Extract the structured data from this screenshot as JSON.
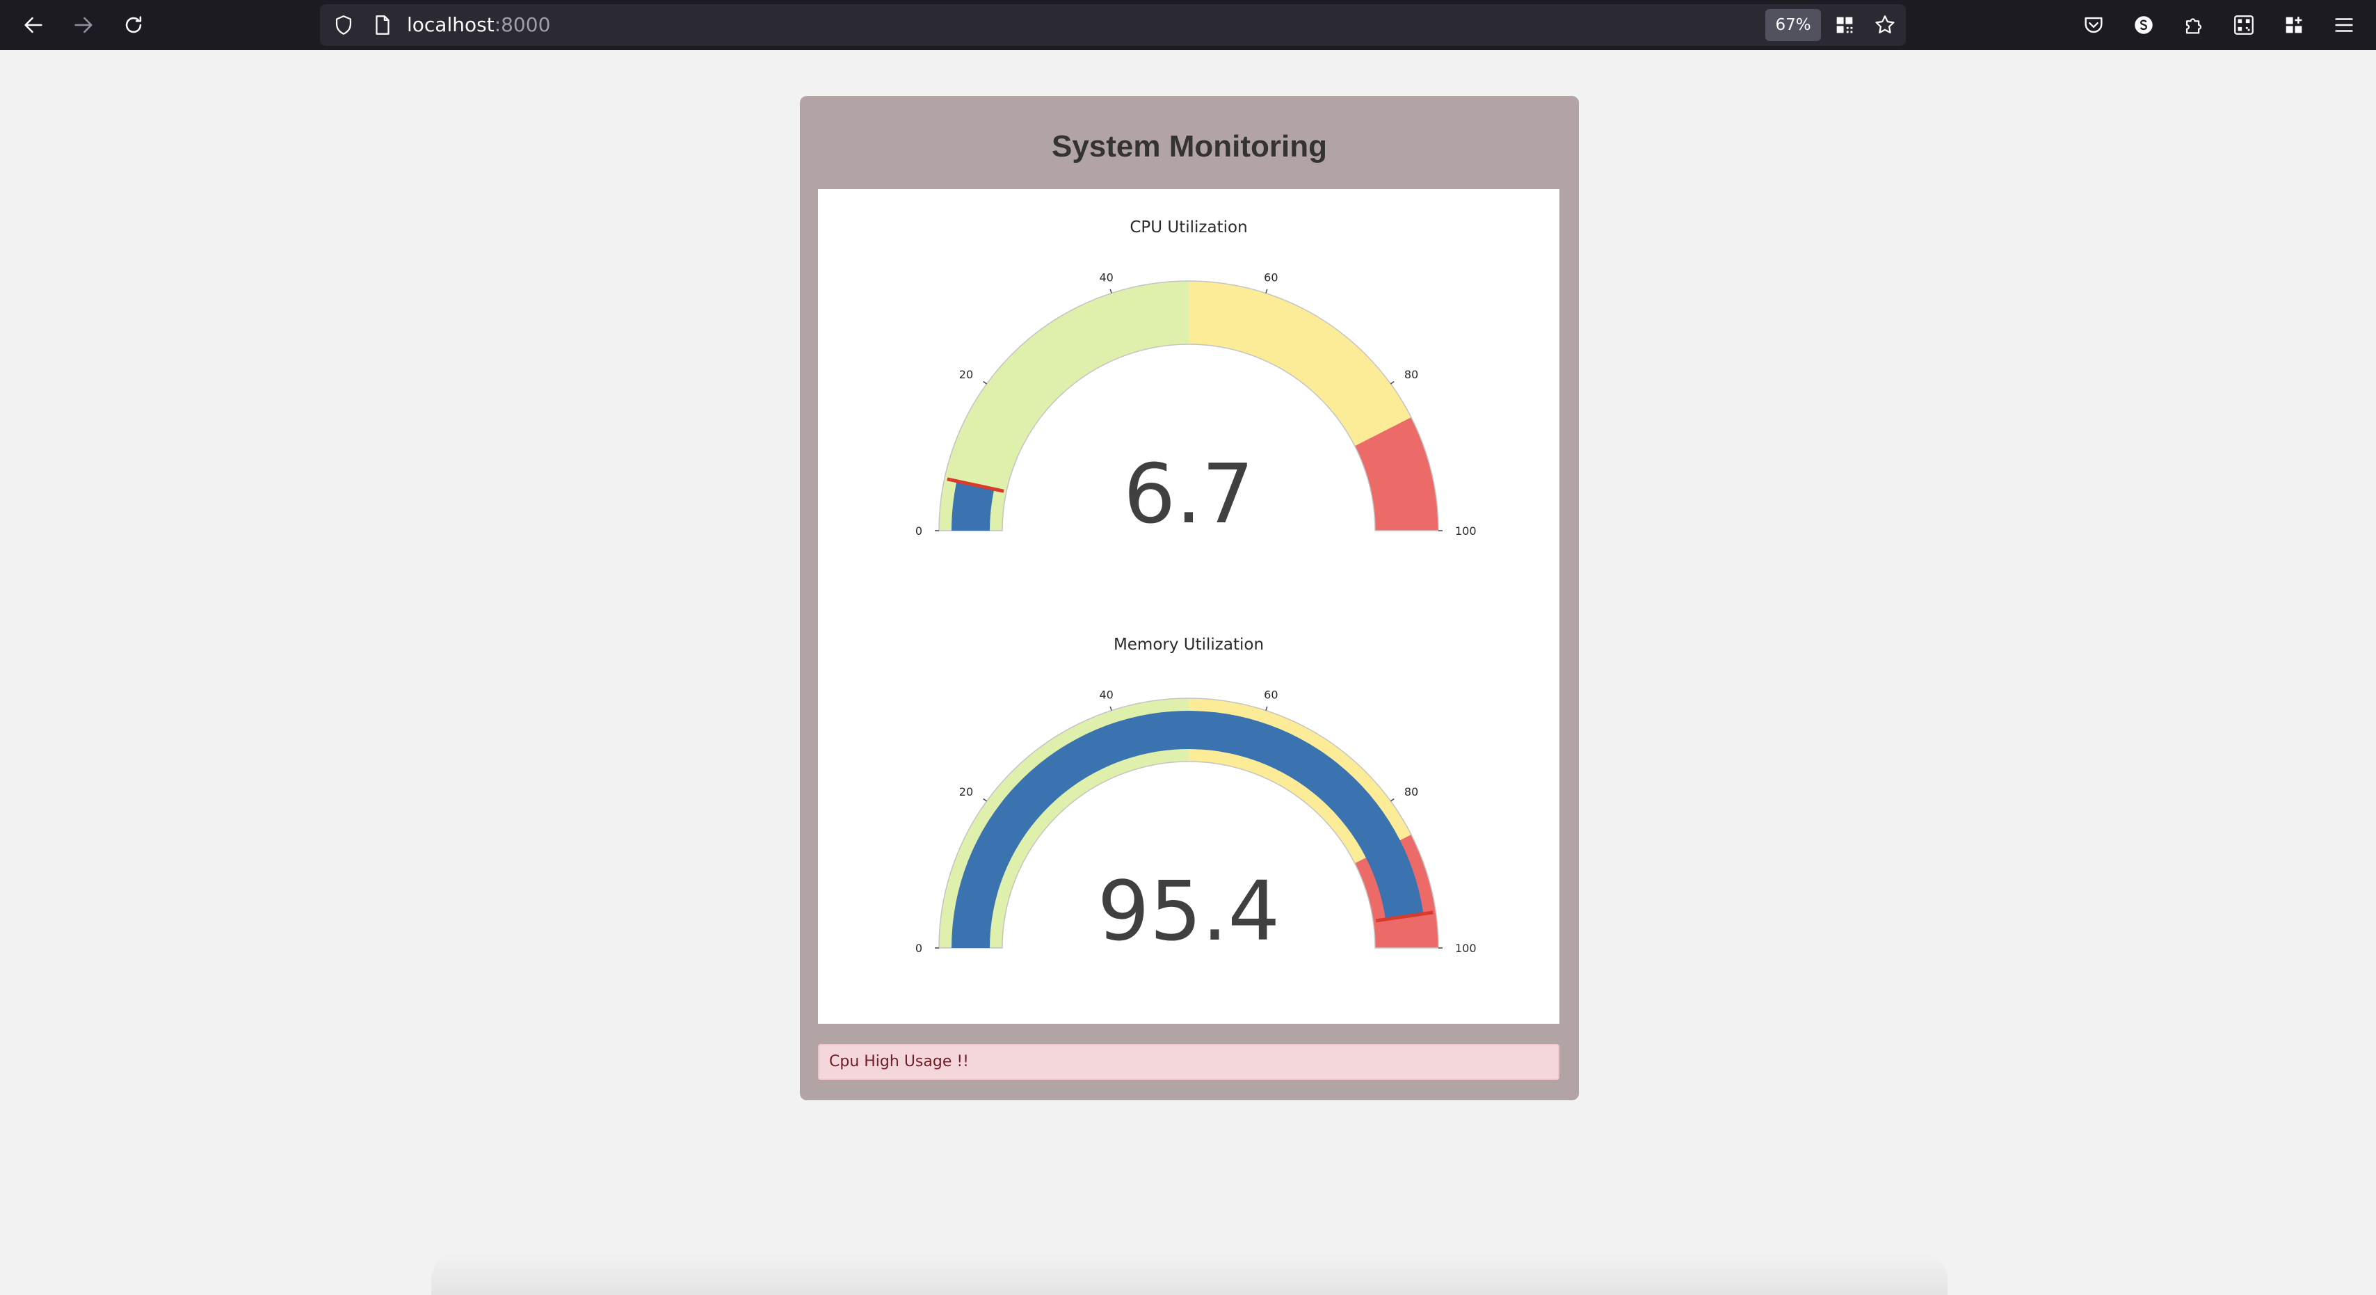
{
  "browser": {
    "url_host": "localhost",
    "url_port": ":8000",
    "zoom": "67%"
  },
  "page": {
    "title": "System Monitoring",
    "alert": "Cpu High Usage !!"
  },
  "colors": {
    "background": "#f2f2f2",
    "card": "#b2a4a4",
    "band_low": "#dff0ac",
    "band_mid": "#fcec97",
    "band_high": "#ec6b69",
    "bar": "#3b73b0",
    "threshold": "#d83a2c",
    "alert_bg": "#f4d7da",
    "alert_text": "#721c24"
  },
  "gauges": [
    {
      "title": "CPU Utilization",
      "value": 6.7,
      "display": "6.7",
      "range": [
        0,
        100
      ],
      "ticks": [
        "0",
        "20",
        "40",
        "60",
        "80",
        "100"
      ],
      "steps": [
        {
          "range": [
            0,
            50
          ],
          "color": "band_low"
        },
        {
          "range": [
            50,
            85
          ],
          "color": "band_mid"
        },
        {
          "range": [
            85,
            100
          ],
          "color": "band_high"
        }
      ],
      "threshold": 6.7
    },
    {
      "title": "Memory Utilization",
      "value": 95.4,
      "display": "95.4",
      "range": [
        0,
        100
      ],
      "ticks": [
        "0",
        "20",
        "40",
        "60",
        "80",
        "100"
      ],
      "steps": [
        {
          "range": [
            0,
            50
          ],
          "color": "band_low"
        },
        {
          "range": [
            50,
            85
          ],
          "color": "band_mid"
        },
        {
          "range": [
            85,
            100
          ],
          "color": "band_high"
        }
      ],
      "threshold": 95.4
    }
  ]
}
